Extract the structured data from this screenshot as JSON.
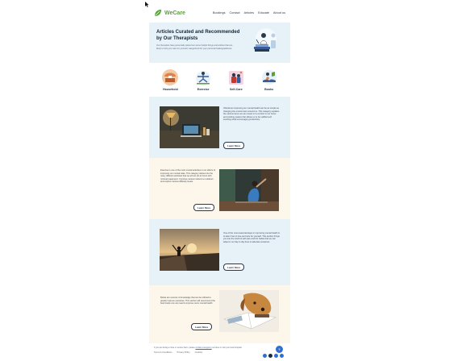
{
  "header": {
    "brand": "WeCare",
    "nav": [
      "Bookings",
      "Contact",
      "Articles",
      "Educate",
      "About us"
    ]
  },
  "hero": {
    "title": "Articles Curated and Recommended by Our Therapists",
    "subtitle": "Our therapists have personally picked out some helpful things and articles that are likely to help you care for yourself, categorized for your personal healing/wellness."
  },
  "categories": [
    {
      "label": "Household",
      "icon": "household-icon"
    },
    {
      "label": "Exercise",
      "icon": "exercise-icon"
    },
    {
      "label": "Self-Care",
      "icon": "self-care-icon"
    },
    {
      "label": "Books",
      "icon": "books-icon"
    }
  ],
  "articles": [
    {
      "text": "Oftentimes improving our mental health can be as simple as changing the environment around us. This category explains the various items we can invest in to comfort in our home and working spaces that allows us to be uplifted and soothing while encouraging productivity.",
      "button": "Learn More",
      "image": "desk-lamp-photo"
    },
    {
      "text": "Exercise is one of the most crucial activities in our efforts of improving our mental state. This category delves into the many different activities that we all can do at home with minimal equipment. Continue various indoors to outdoors and explore various difficulty levels.",
      "button": "Learn More",
      "image": "yoga-photo"
    },
    {
      "text": "One of the most essential steps in improving mental health is to learn how to love and care for yourself. This section brings you into the world of self-care and the habits that we can adopt in our day to day lives to alleviate ourselves.",
      "button": "Learn More",
      "image": "sunset-pier-photo"
    },
    {
      "text": "Books are sources of knowledge that can be utilized to greatly improve ourselves. This section will recommend the best books one can read to improve one's mental health.",
      "button": "Learn More",
      "image": "dog-book-photo"
    }
  ],
  "footer": {
    "text_prefix": "If you are facing a crisis or serious harm, please",
    "link": "contact emergency",
    "text_suffix": "services or visit your local hospital.",
    "links": [
      "Terms & Conditions",
      "Privacy Policy",
      "Cookies"
    ],
    "socials": [
      "facebook-icon",
      "instagram-icon",
      "twitter-icon",
      "linkedin-icon"
    ],
    "help_glyph": "?"
  },
  "colors": {
    "brand_green": "#5aa13a",
    "hero_blue": "#e7f1f8",
    "cream": "#fdf6ea",
    "accent_blue": "#2f6fd1"
  }
}
